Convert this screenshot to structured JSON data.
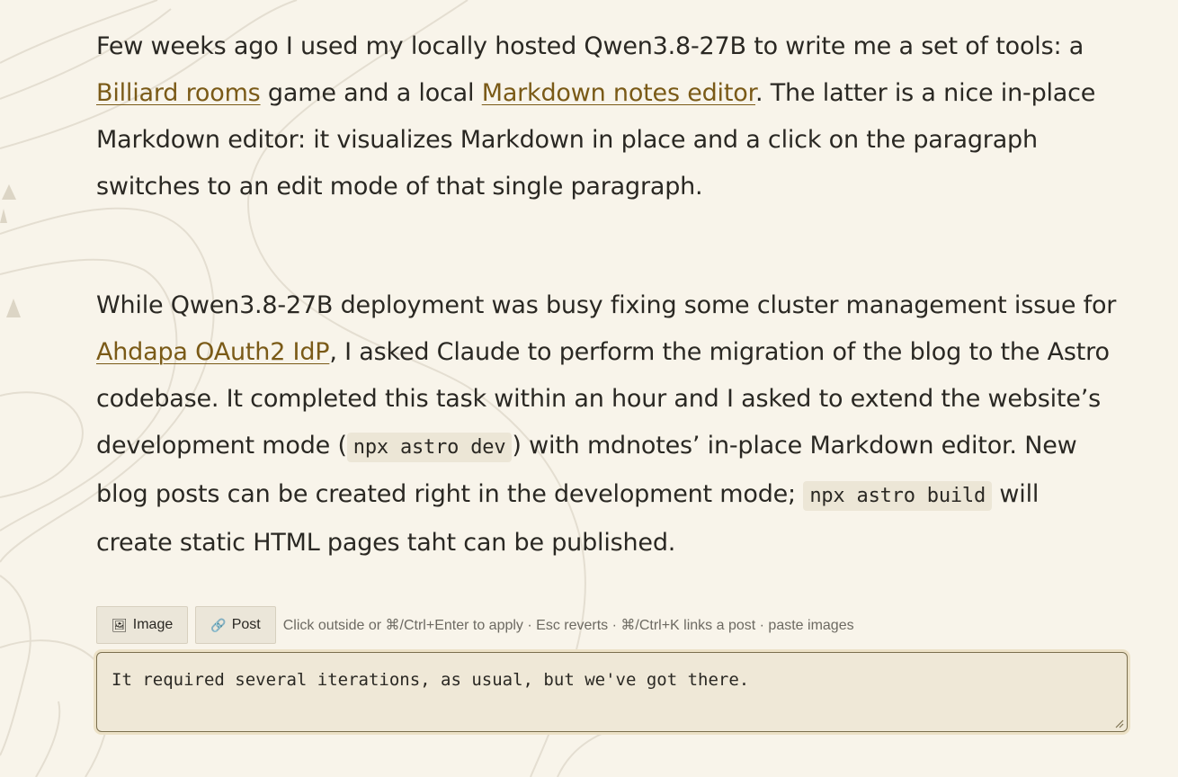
{
  "paragraphs": [
    {
      "t1": "Few weeks ago I used my locally hosted Qwen3.8-27B to write me a set of tools: a ",
      "link1": "Billiard rooms",
      "t2": " game and a local ",
      "link2": "Markdown notes editor",
      "t3": ". The latter is a nice in-place Markdown editor: it visualizes Markdown in place and a click on the paragraph switches to an edit mode of that single paragraph."
    },
    {
      "t1": "While Qwen3.8-27B deployment was busy fixing some cluster management issue for ",
      "link1": "Ahdapa OAuth2 IdP",
      "t2": ", I asked Claude to perform the migration of the blog to the Astro codebase. It completed this task within an hour and I asked to extend the website’s development mode (",
      "code1": "npx astro dev",
      "t3": ") with mdnotes’ in-place Markdown editor. New blog posts can be created right in the development mode; ",
      "code2": "npx astro build",
      "t4": " will create static HTML pages taht can be published."
    }
  ],
  "toolbar": {
    "image_icon": "🖼",
    "image_label": "Image",
    "post_icon": "🔗",
    "post_label": "Post",
    "hint": "Click outside or ⌘/Ctrl+Enter to apply · Esc reverts · ⌘/Ctrl+K links a post · paste images"
  },
  "editor": {
    "value": "It required several iterations, as usual, but we've got there."
  },
  "colors": {
    "background": "#f8f4ea",
    "link": "#7a5a17",
    "text": "#2a2823"
  }
}
